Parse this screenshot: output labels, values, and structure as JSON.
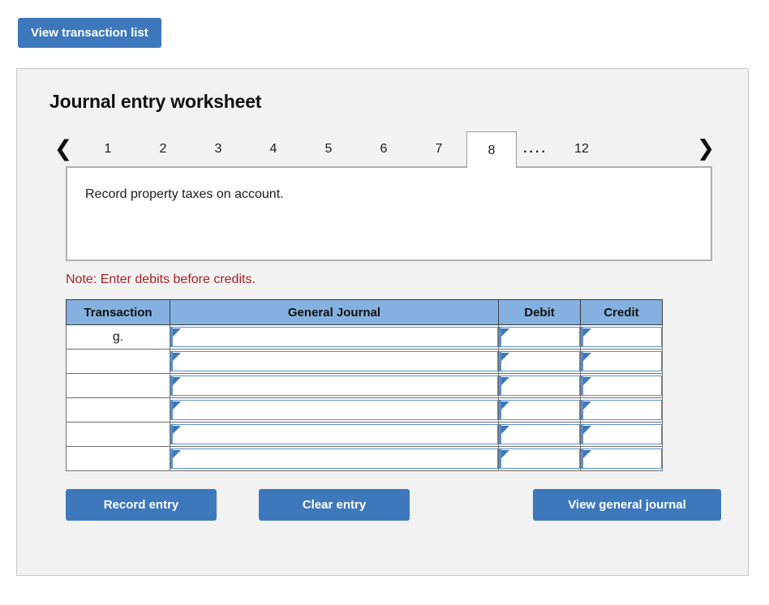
{
  "top": {
    "view_transaction_list_label": "View transaction list"
  },
  "panel": {
    "title": "Journal entry worksheet",
    "prev_icon": "chevron-left-icon",
    "next_icon": "chevron-right-icon",
    "tabs": [
      {
        "label": "1",
        "active": false
      },
      {
        "label": "2",
        "active": false
      },
      {
        "label": "3",
        "active": false
      },
      {
        "label": "4",
        "active": false
      },
      {
        "label": "5",
        "active": false
      },
      {
        "label": "6",
        "active": false
      },
      {
        "label": "7",
        "active": false
      },
      {
        "label": "8",
        "active": true
      },
      {
        "label": "....",
        "active": false
      },
      {
        "label": "12",
        "active": false
      }
    ],
    "description": "Record property taxes on account.",
    "note": "Note: Enter debits before credits."
  },
  "table": {
    "headers": [
      "Transaction",
      "General Journal",
      "Debit",
      "Credit"
    ],
    "rows": [
      {
        "transaction": "g.",
        "general_journal": "",
        "debit": "",
        "credit": ""
      },
      {
        "transaction": "",
        "general_journal": "",
        "debit": "",
        "credit": ""
      },
      {
        "transaction": "",
        "general_journal": "",
        "debit": "",
        "credit": ""
      },
      {
        "transaction": "",
        "general_journal": "",
        "debit": "",
        "credit": ""
      },
      {
        "transaction": "",
        "general_journal": "",
        "debit": "",
        "credit": ""
      },
      {
        "transaction": "",
        "general_journal": "",
        "debit": "",
        "credit": ""
      }
    ]
  },
  "actions": {
    "record_entry_label": "Record entry",
    "clear_entry_label": "Clear entry",
    "view_general_journal_label": "View general journal"
  },
  "colors": {
    "button_blue": "#3d78bc",
    "header_blue": "#84b1e0",
    "field_blue": "#5b8fc9",
    "note_red": "#a52226",
    "panel_bg": "#f2f2f2",
    "panel_border": "#c9c9c9"
  }
}
